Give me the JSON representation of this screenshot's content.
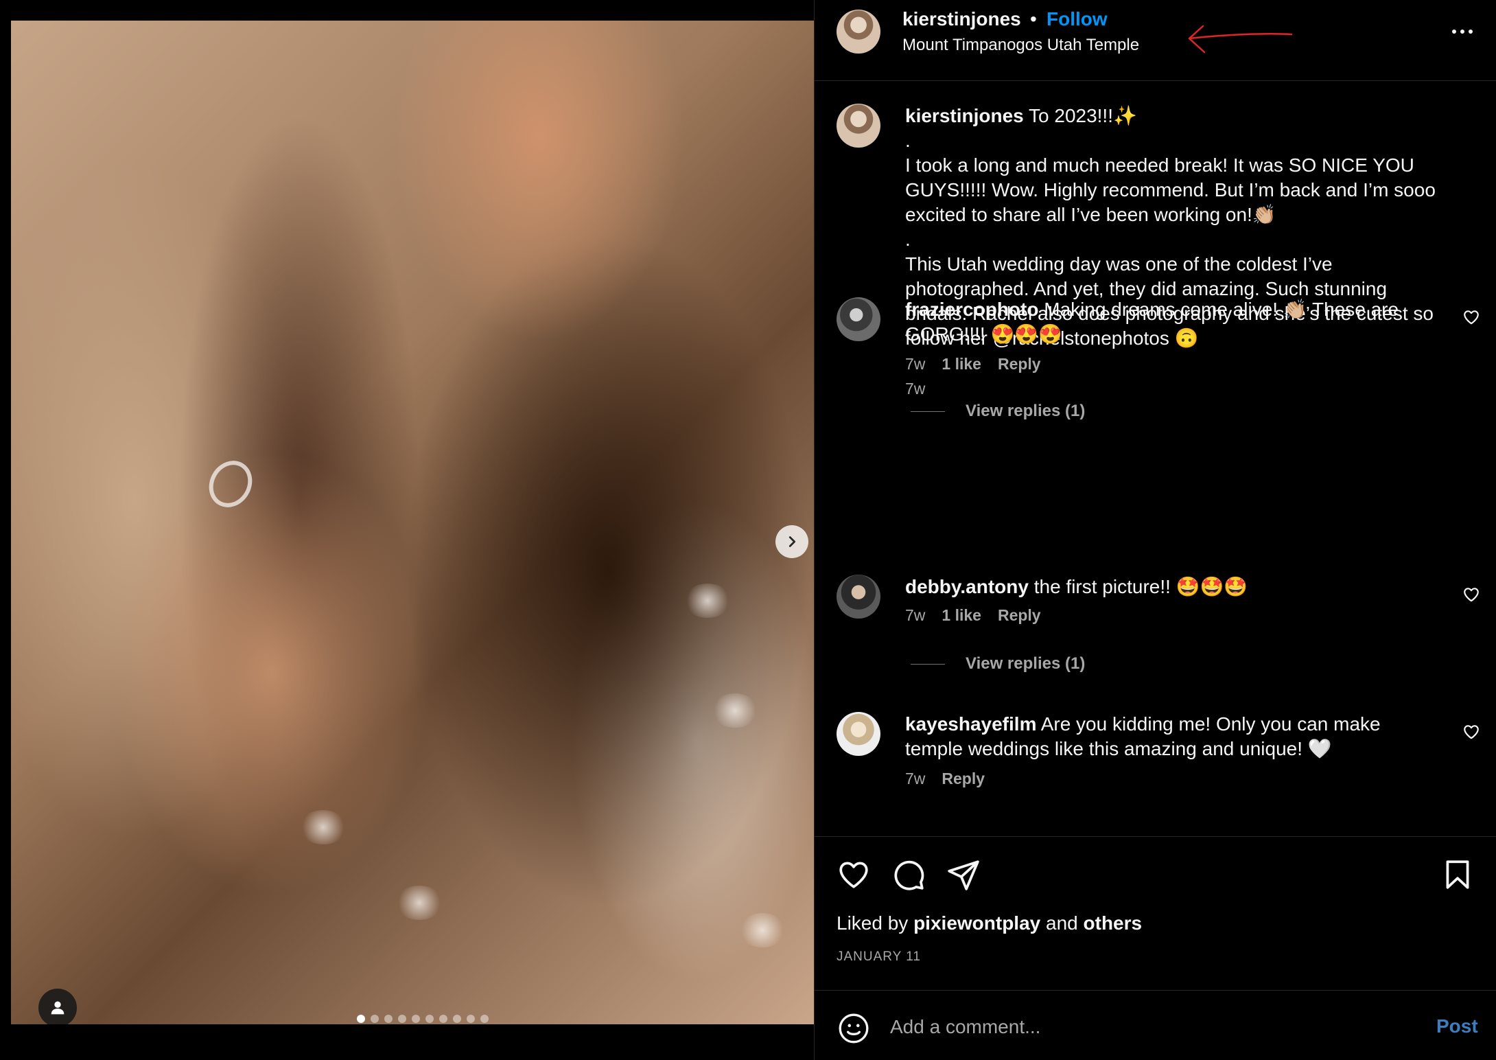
{
  "post": {
    "dots_count": 10,
    "active_dot": 0
  },
  "header": {
    "username": "kierstinjones",
    "separator": "•",
    "follow_label": "Follow",
    "location": "Mount Timpanogos Utah Temple",
    "annotation_arrow_color": "#e0242b"
  },
  "caption": {
    "username": "kierstinjones",
    "first_line": "To 2023!!!✨",
    "body": ".\nI took a long and much needed break! It was SO NICE YOU GUYS!!!!! Wow. Highly recommend. But I’m back and I’m sooo excited to share all I’ve been working on!👏🏼\n.\nThis Utah wedding day was one of the coldest I’ve photographed. And yet, they did amazing. Such stunning bridals. Rachel also does photography and she’s the cutest so follow her @rachelstonephotos 🙃",
    "time": "7w"
  },
  "comments": [
    {
      "username": "fraziercophoto",
      "text": "Making dreams come alive! 👏🏼 These are GORG!!!! 😍😍😍",
      "time": "7w",
      "likes": "1 like",
      "reply": "Reply",
      "view_replies": "View replies (1)"
    },
    {
      "username": "debby.antony",
      "text": "the first picture!! 🤩🤩🤩",
      "time": "7w",
      "likes": "1 like",
      "reply": "Reply",
      "view_replies": "View replies (1)"
    },
    {
      "username": "kayeshayefilm",
      "text": "Are you kidding me! Only you can make temple weddings like this amazing and unique! 🤍",
      "time": "7w",
      "reply": "Reply"
    }
  ],
  "actions": {
    "liked_by_prefix": "Liked by",
    "liked_by_user": "pixiewontplay",
    "liked_by_and": "and",
    "liked_by_others": "others",
    "date": "JANUARY 11"
  },
  "add_comment": {
    "placeholder": "Add a comment...",
    "post_label": "Post"
  },
  "colors": {
    "accent": "#0095f6",
    "post_button": "#3d7ebf",
    "secondary_text": "#a8a8a8",
    "background": "#000000"
  }
}
